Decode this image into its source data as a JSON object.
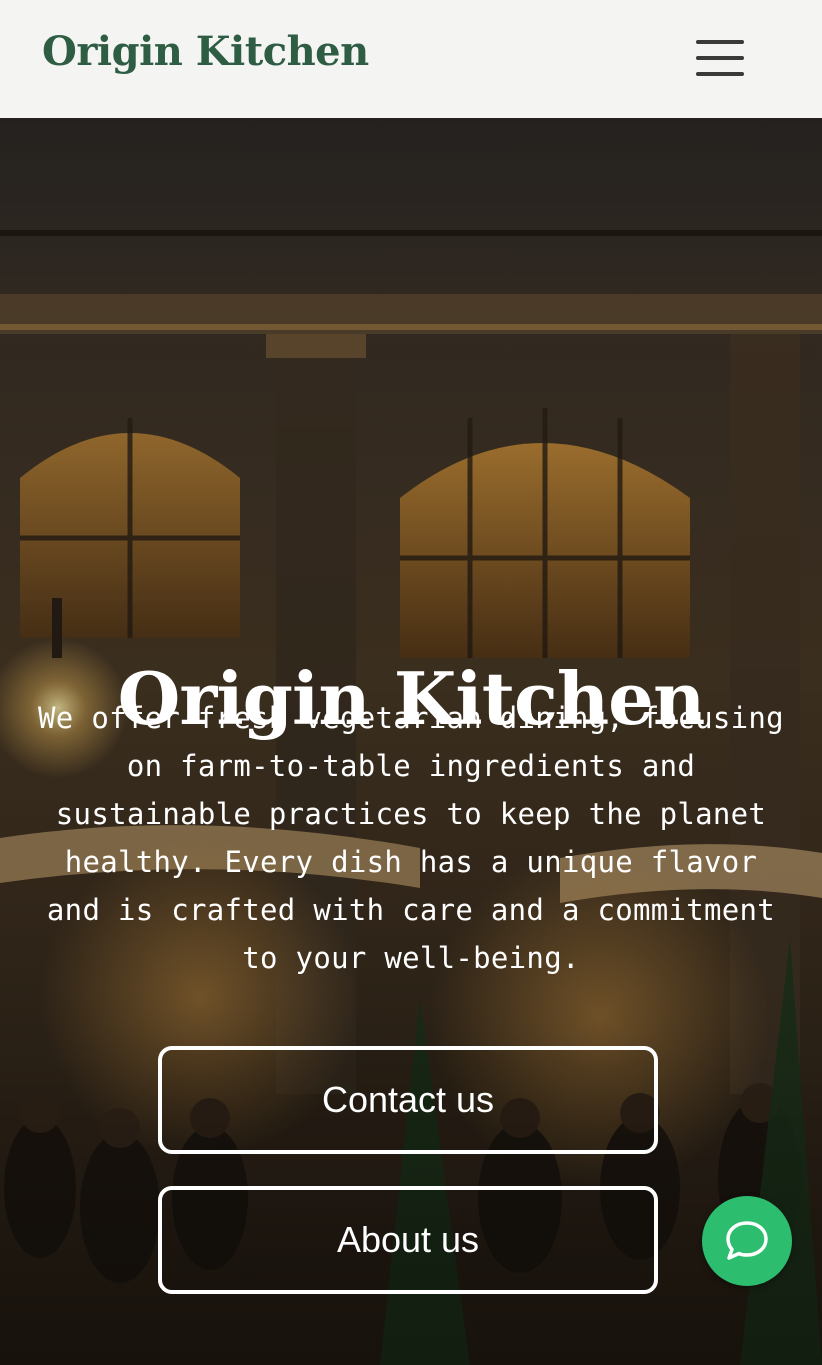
{
  "header": {
    "brand": "Origin Kitchen",
    "menu_icon": "hamburger-menu-icon"
  },
  "hero": {
    "title": "Origin Kitchen",
    "description": "We offer fresh vegetarian dining, focusing on farm-to-table ingredients and sustainable practices to keep the planet healthy. Every dish has a unique flavor and is crafted with care and a commitment to your well-being.",
    "buttons": {
      "contact": "Contact us",
      "about": "About us"
    }
  },
  "chat": {
    "icon": "chat-bubble-icon"
  },
  "colors": {
    "brand": "#2f5d43",
    "chat": "#2dbd6e"
  }
}
